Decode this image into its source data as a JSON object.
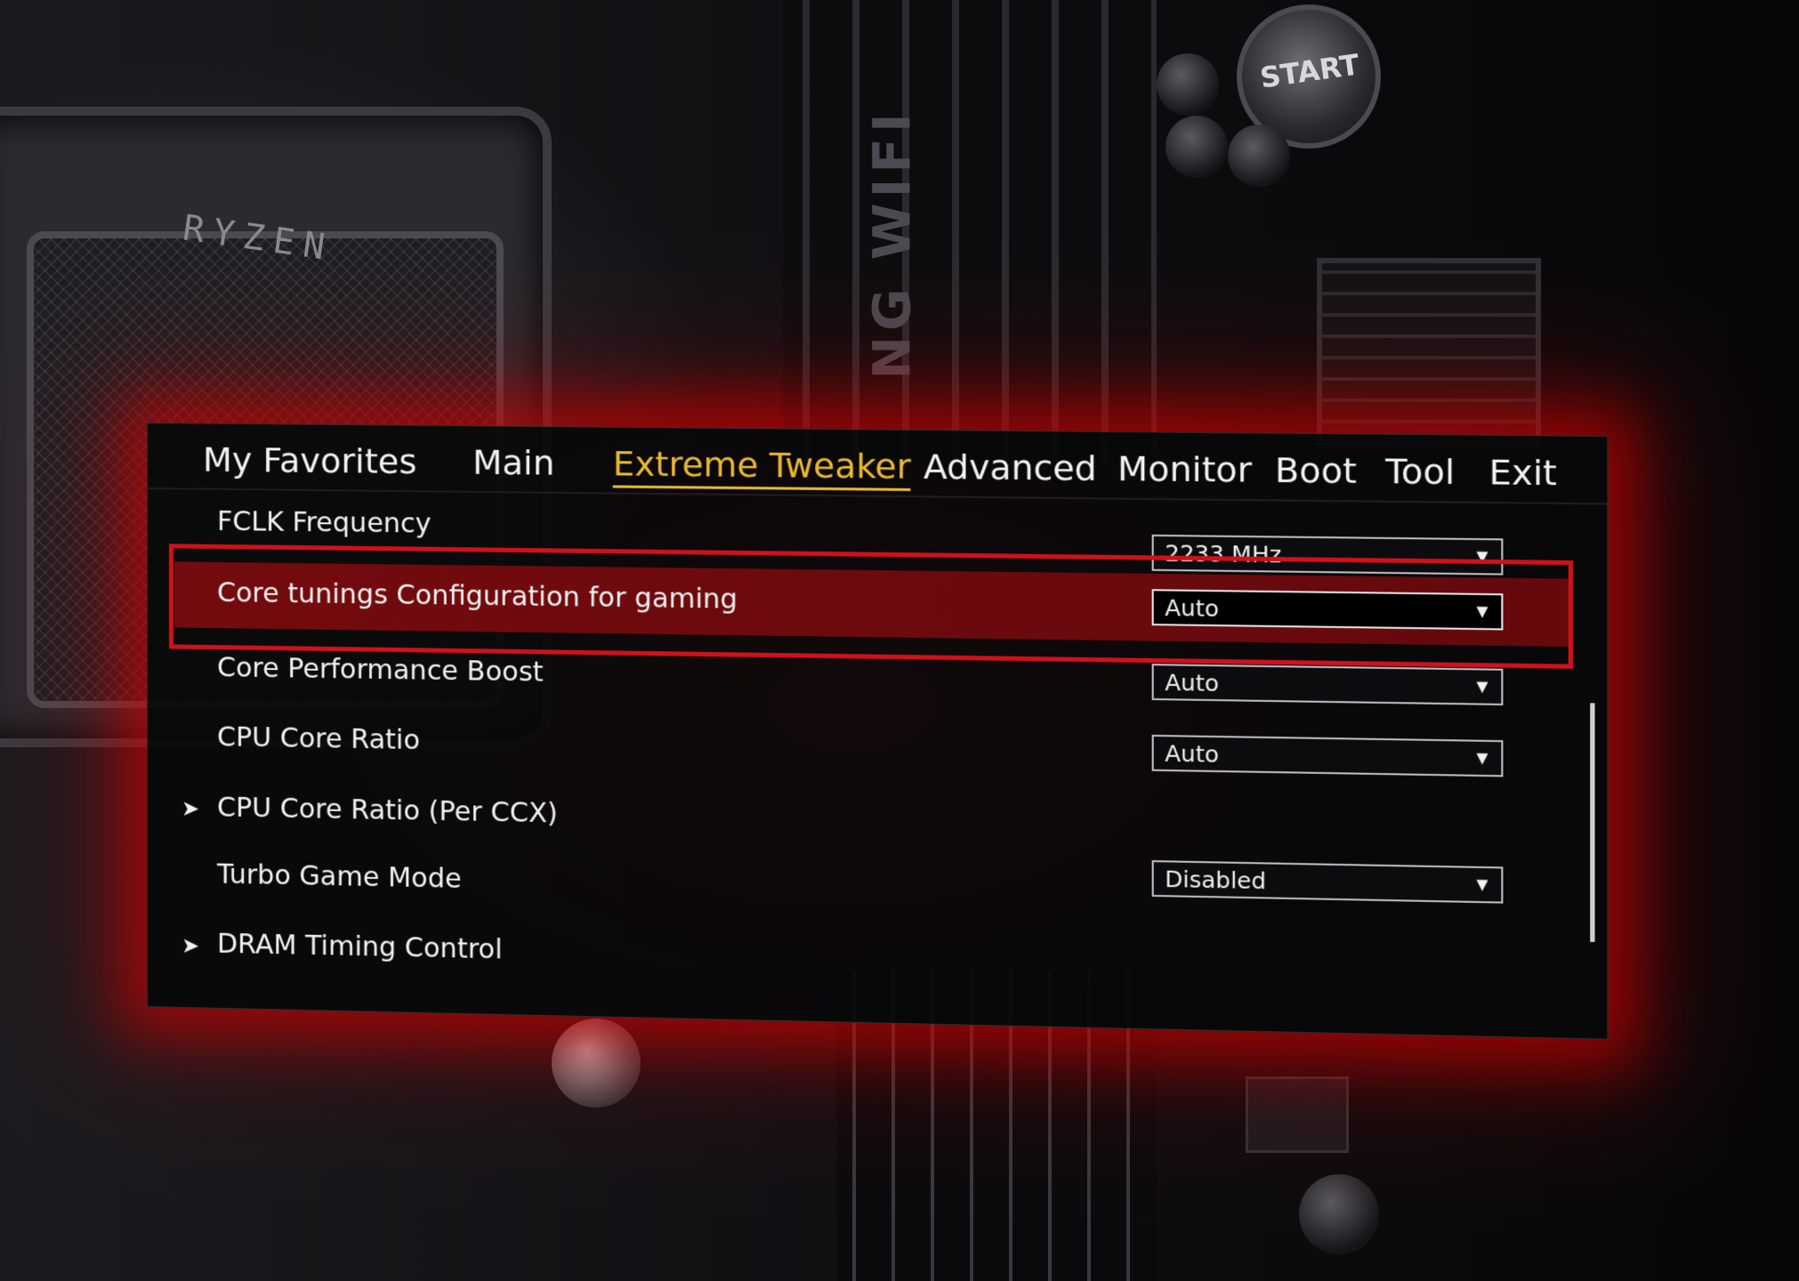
{
  "backdrop": {
    "brand_text": "RYZEN",
    "board_text": "NG WIFI",
    "button_text": "START"
  },
  "tabs": [
    {
      "label": "My Favorites"
    },
    {
      "label": "Main"
    },
    {
      "label": "Extreme Tweaker",
      "active": true
    },
    {
      "label": "Advanced"
    },
    {
      "label": "Monitor"
    },
    {
      "label": "Boot"
    },
    {
      "label": "Tool"
    },
    {
      "label": "Exit"
    }
  ],
  "settings": [
    {
      "label": "FCLK Frequency",
      "value": "2233 MHz"
    },
    {
      "label": "Core tunings Configuration for gaming",
      "value": "Auto",
      "highlighted": true
    },
    {
      "label": "Core Performance Boost",
      "value": "Auto"
    },
    {
      "label": "CPU Core Ratio",
      "value": "Auto"
    },
    {
      "label": "CPU Core Ratio (Per CCX)",
      "submenu": true
    },
    {
      "label": "Turbo Game Mode",
      "value": "Disabled"
    },
    {
      "label": "DRAM Timing Control",
      "submenu": true
    }
  ],
  "icons": {
    "submenu": "chevron-right-icon",
    "dropdown": "caret-down-icon"
  },
  "colors": {
    "active_tab": "#e8b931",
    "highlight_frame": "#d0111b",
    "glow": "#ff1414"
  }
}
